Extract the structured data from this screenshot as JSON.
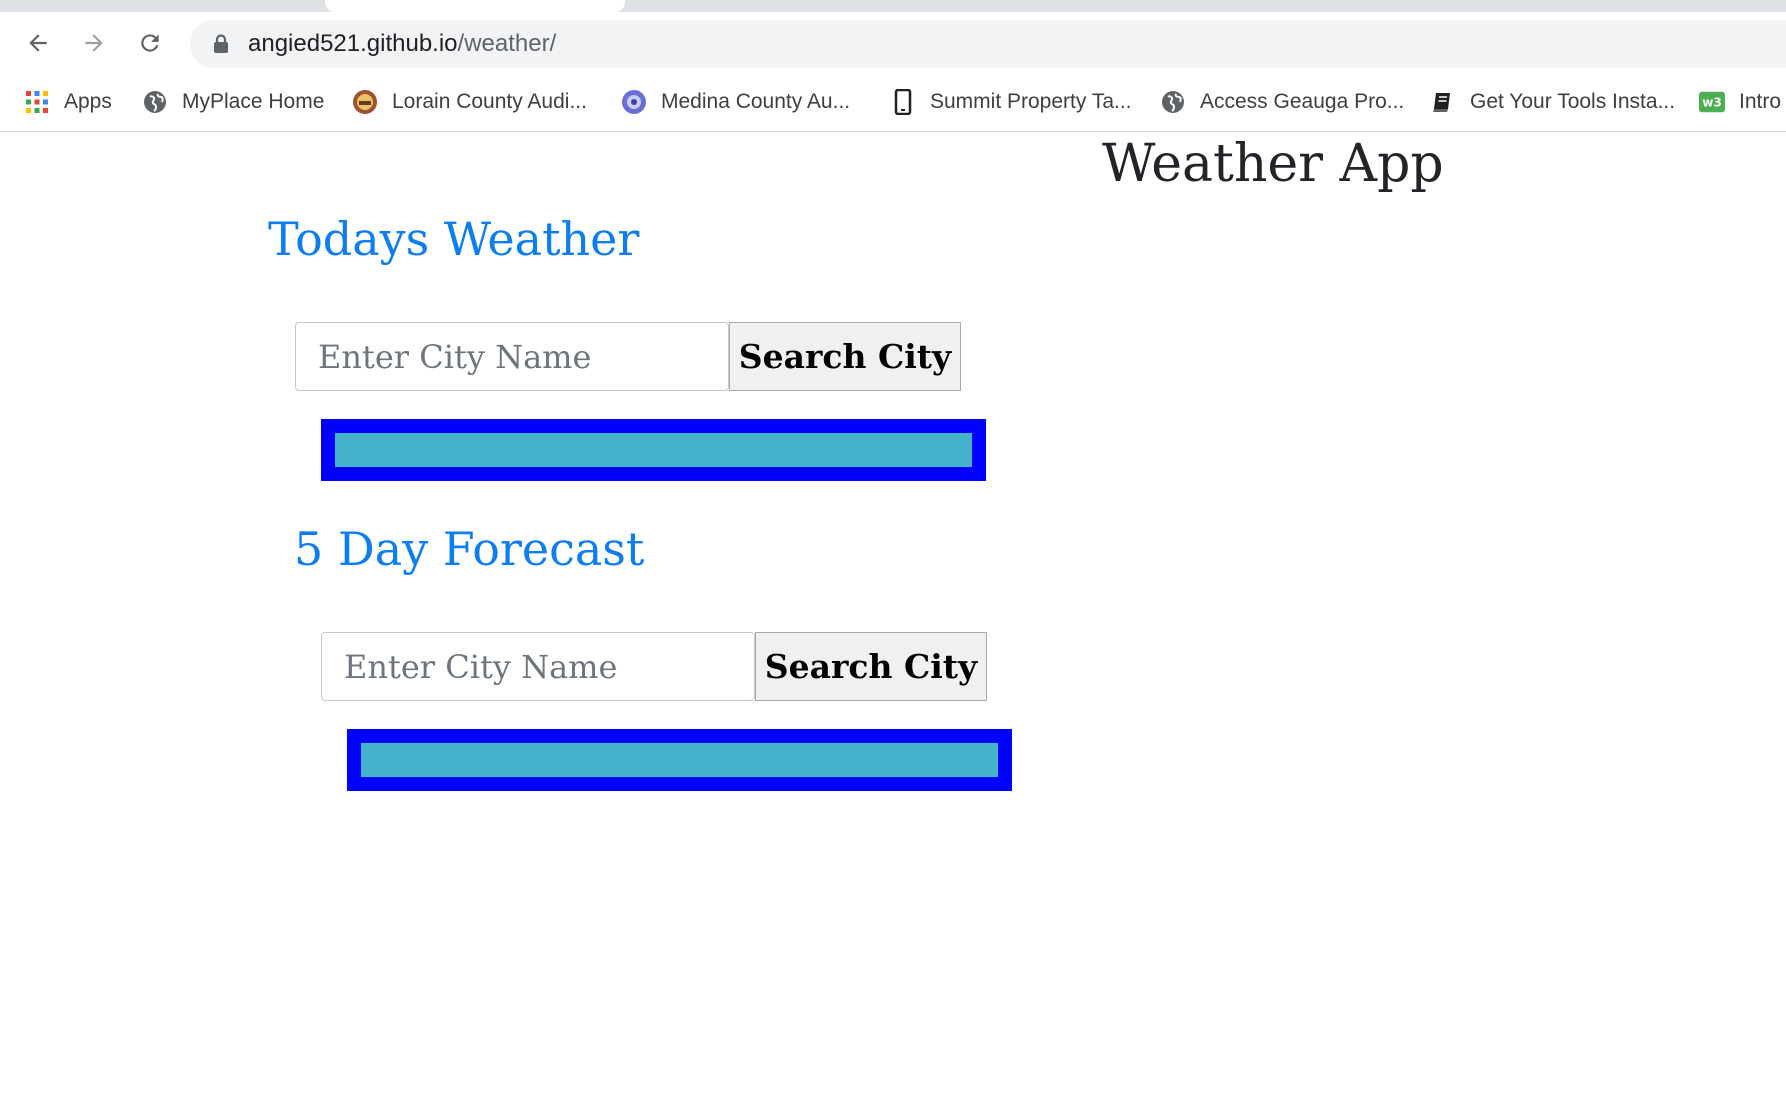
{
  "browser": {
    "url_domain": "angied521.github.io",
    "url_path": "/weather/",
    "nav_icons": [
      "back-arrow-icon",
      "forward-arrow-icon",
      "reload-icon"
    ],
    "bookmarks": [
      {
        "label": "Apps",
        "icon": "apps-grid-icon"
      },
      {
        "label": "MyPlace Home",
        "icon": "globe-icon"
      },
      {
        "label": "Lorain County Audi...",
        "icon": "county-seal-icon"
      },
      {
        "label": "Medina County Au...",
        "icon": "county-seal-icon"
      },
      {
        "label": "Summit Property Ta...",
        "icon": "phone-icon"
      },
      {
        "label": "Access Geauga Pro...",
        "icon": "globe-icon"
      },
      {
        "label": "Get Your Tools Insta...",
        "icon": "book-icon"
      },
      {
        "label": "Intro",
        "icon": "w3-icon"
      }
    ]
  },
  "page": {
    "app_title": "Weather App",
    "today": {
      "heading": "Todays Weather",
      "input_placeholder": "Enter City Name",
      "button_label": "Search City"
    },
    "forecast": {
      "heading": "5 Day Forecast",
      "input_placeholder": "Enter City Name",
      "button_label": "Search City"
    }
  },
  "colors": {
    "heading_blue": "#0d7ef1",
    "result_border": "#0000ff",
    "result_fill": "#44b3c9"
  }
}
